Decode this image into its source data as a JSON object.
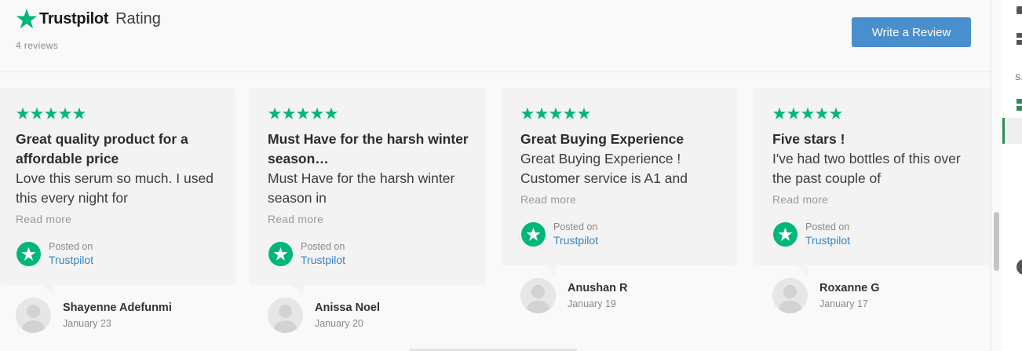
{
  "header": {
    "brand": "Trustpilot",
    "rating_word": "Rating",
    "review_count": "4 reviews",
    "write_button": "Write a Review"
  },
  "colors": {
    "trustpilot_green": "#00b67a",
    "button_blue": "#4a8fcd",
    "link_blue": "#3a84c4"
  },
  "reviews": [
    {
      "rating": 5,
      "title": "Great quality product for a affordable price",
      "body": "Love this serum so much. I used this every night for",
      "read_more": "Read more",
      "posted_on": "Posted on",
      "source": "Trustpilot",
      "author": "Shayenne Adefunmi",
      "date": "January 23"
    },
    {
      "rating": 5,
      "title": "Must Have for the harsh winter season…",
      "body": "Must Have for the harsh winter season in",
      "read_more": "Read more",
      "posted_on": "Posted on",
      "source": "Trustpilot",
      "author": "Anissa Noel",
      "date": "January 20"
    },
    {
      "rating": 5,
      "title": "Great Buying Experience",
      "body": "Great Buying Experience ! Customer service is A1 and",
      "read_more": "Read more",
      "posted_on": "Posted on",
      "source": "Trustpilot",
      "author": "Anushan R",
      "date": "January 19"
    },
    {
      "rating": 5,
      "title": "Five stars !",
      "body": "I've had two bottles of this over the past couple of",
      "read_more": "Read more",
      "posted_on": "Posted on",
      "source": "Trustpilot",
      "author": "Roxanne G",
      "date": "January 17"
    }
  ],
  "sidebar": {
    "label": "S."
  },
  "icons": {
    "logo": "trustpilot-star-icon",
    "rating_star": "star-icon",
    "posted_badge": "trustpilot-badge-icon",
    "avatar": "user-avatar-icon"
  }
}
